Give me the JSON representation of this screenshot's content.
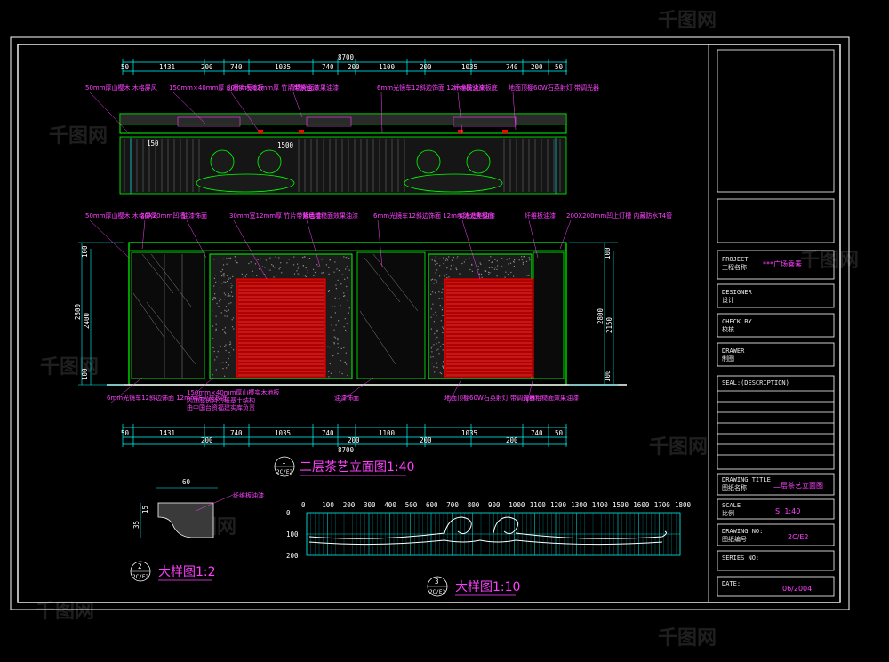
{
  "watermark": "千图网",
  "title_block": {
    "project_label": "PROJECT",
    "project_label_cn": "工程名称",
    "project_value": "***广场乘素",
    "designer_label": "DESIGNER",
    "designer_label_cn": "设计",
    "check_label": "CHECK BY",
    "check_label_cn": "校核",
    "drawer_label": "DRAWER",
    "drawer_label_cn": "制图",
    "seal_label": "SEAL:(DESCRIPTION)",
    "drawing_title_label": "DRAWING TITLE",
    "drawing_title_label_cn": "图纸名称",
    "drawing_title_value": "二层茶艺立面图",
    "scale_label": "SCALE",
    "scale_label_cn": "比例",
    "scale_value": "S:  1:40",
    "drawing_no_label": "DRAWING    NO:",
    "drawing_no_label_cn": "图纸编号",
    "drawing_no_value": "2C/E2",
    "series_label": "SERIES NO:",
    "date_label": "DATE:",
    "date_value": "06/2004"
  },
  "dimensions": {
    "overall": "8700",
    "top_segments": [
      "50",
      "1431",
      "200",
      "740",
      "1035",
      "740",
      "200",
      "1100",
      "200",
      "1035",
      "740",
      "200",
      "50"
    ],
    "bottom_segments_row1": [
      "50",
      "1431",
      "740",
      "1035",
      "740",
      "1100",
      "1035",
      "740",
      "50"
    ],
    "bottom_segments_row2": [
      "200",
      "200",
      "200",
      "200"
    ],
    "plan_dim": "1500",
    "plan_dim2": "150",
    "left_vertical": [
      "2800",
      "2400",
      "100",
      "100"
    ],
    "right_vertical": [
      "2800",
      "2150",
      "100",
      "100"
    ],
    "left_small": [
      "100",
      "100"
    ]
  },
  "notes_top": [
    "50mm厚山樱木 木格屏风",
    "150mm×40mm厚 山樱实木地板",
    "30mm宽12mm厚 竹片带紫色漆",
    "背墙光面效果油漆",
    "6mm光镜车12斜边饰面 12mm防火夹板底",
    "纤维板油漆",
    "地面顶棚60W石英射灯 带调光器"
  ],
  "notes_mid": [
    "50mm厚山樱木 木格屏风",
    "20X20mm凹槽",
    "油漆饰面",
    "30mm宽12mm厚 竹片带紫色漆",
    "背墙粗糙面效果油漆",
    "6mm光镜车12斜边饰面 12mm防火夹板底",
    "实木造型油漆",
    "纤维板油漆",
    "200X200mm凹上灯槽 内藏防水T4管"
  ],
  "notes_bottom": [
    "6mm光镜车12斜边饰面 12mm防火夹板底",
    "150mm×40mm厚山樱实木地板",
    "内加高透台力纸基土结构",
    "由中国台资福建实库负责",
    "油漆饰面",
    "地面顶棚60W石英射灯 带调光器",
    "背墙粗糙面效果油漆"
  ],
  "view_titles": {
    "main": "二层茶艺立面图1:40",
    "main_ref_top": "1",
    "main_ref_bottom": "2C/E2",
    "detail1": "大样图1:2",
    "detail1_ref_top": "2",
    "detail1_ref_bottom": "2C/E2",
    "detail2": "大样图1:10",
    "detail2_ref_top": "3",
    "detail2_ref_bottom": "2C/E2"
  },
  "detail1": {
    "dim": "60",
    "side_dims": [
      "35",
      "15"
    ],
    "note": "纤维板油漆"
  },
  "detail2": {
    "x_ticks": [
      "0",
      "100",
      "200",
      "300",
      "400",
      "500",
      "600",
      "700",
      "800",
      "900",
      "1000",
      "1100",
      "1200",
      "1300",
      "1400",
      "1500",
      "1600",
      "1700",
      "1800"
    ],
    "y_ticks": [
      "0",
      "100",
      "200"
    ]
  },
  "colors": {
    "background": "#000000",
    "frame": "#ffffff",
    "cyan": "#00ffff",
    "green": "#00ff00",
    "magenta": "#ff40ff",
    "red": "#ff0000",
    "yellow": "#ffff00"
  }
}
